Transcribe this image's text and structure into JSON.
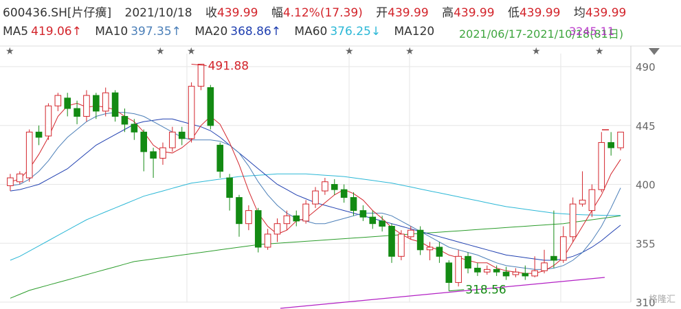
{
  "header": {
    "symbol": "600436.SH[片仔癀]",
    "date": "2021/10/18",
    "close_label": "收",
    "close": "439.99",
    "change_label": "幅",
    "change": "4.12%(17.39)",
    "open_label": "开",
    "open": "439.99",
    "high_label": "高",
    "high": "439.99",
    "low_label": "低",
    "low": "439.99",
    "avg_label": "均",
    "avg": "439.99"
  },
  "ma_row": {
    "ma5": "MA5",
    "ma5_val": "419.06↑",
    "ma10": "MA10",
    "ma10_val": "397.35↑",
    "ma20": "MA20",
    "ma20_val": "368.86↑",
    "ma60": "MA60",
    "ma60_val": "376.25↓",
    "ma120": "MA120",
    "ma120_val": "",
    "ma250_val": "3245.11",
    "overlay_text": "2021/06/17-2021/10/18(81日)"
  },
  "watermark": "格隆汇",
  "colors": {
    "up": "#d3242b",
    "down": "#138a13",
    "grid": "#e5e5e5"
  },
  "chart_data": {
    "type": "candlestick",
    "ylim": [
      310,
      500
    ],
    "yticks": [
      490,
      445,
      400,
      355,
      310
    ],
    "annotations": [
      {
        "text": "491.88",
        "x_index": 19,
        "y": 491.88
      },
      {
        "text": "318.56",
        "x_index": 46,
        "y": 318.56
      }
    ],
    "candles": [
      [
        399,
        405,
        395,
        408
      ],
      [
        402,
        408,
        400,
        410
      ],
      [
        405,
        440,
        402,
        442
      ],
      [
        440,
        436,
        430,
        445
      ],
      [
        437,
        460,
        434,
        462
      ],
      [
        460,
        468,
        456,
        470
      ],
      [
        466,
        458,
        452,
        470
      ],
      [
        458,
        452,
        446,
        464
      ],
      [
        452,
        468,
        448,
        472
      ],
      [
        468,
        456,
        450,
        470
      ],
      [
        456,
        470,
        452,
        474
      ],
      [
        470,
        452,
        448,
        472
      ],
      [
        452,
        446,
        440,
        458
      ],
      [
        446,
        440,
        434,
        450
      ],
      [
        440,
        425,
        410,
        442
      ],
      [
        425,
        420,
        405,
        428
      ],
      [
        420,
        428,
        415,
        432
      ],
      [
        428,
        440,
        425,
        444
      ],
      [
        440,
        435,
        430,
        444
      ],
      [
        435,
        475,
        432,
        478
      ],
      [
        475,
        491.88,
        472,
        491.88
      ],
      [
        474,
        445,
        442,
        476
      ],
      [
        430,
        410,
        405,
        432
      ],
      [
        405,
        390,
        380,
        408
      ],
      [
        390,
        370,
        360,
        392
      ],
      [
        370,
        380,
        365,
        384
      ],
      [
        380,
        352,
        348,
        382
      ],
      [
        352,
        362,
        350,
        366
      ],
      [
        362,
        370,
        356,
        374
      ],
      [
        370,
        376,
        365,
        380
      ],
      [
        376,
        372,
        368,
        380
      ],
      [
        372,
        385,
        370,
        388
      ],
      [
        385,
        395,
        382,
        398
      ],
      [
        395,
        402,
        392,
        405
      ],
      [
        400,
        396,
        392,
        404
      ],
      [
        396,
        390,
        386,
        400
      ],
      [
        390,
        380,
        376,
        394
      ],
      [
        380,
        375,
        372,
        384
      ],
      [
        375,
        370,
        366,
        380
      ],
      [
        372,
        368,
        364,
        376
      ],
      [
        368,
        345,
        340,
        370
      ],
      [
        345,
        362,
        342,
        365
      ],
      [
        360,
        365,
        358,
        368
      ],
      [
        365,
        350,
        346,
        368
      ],
      [
        350,
        352,
        342,
        356
      ],
      [
        352,
        345,
        340,
        356
      ],
      [
        340,
        325,
        318.56,
        342
      ],
      [
        325,
        345,
        322,
        350
      ],
      [
        345,
        336,
        332,
        348
      ],
      [
        336,
        333,
        330,
        340
      ],
      [
        333,
        335,
        331,
        338
      ],
      [
        335,
        333,
        330,
        338
      ],
      [
        333,
        330,
        327,
        337
      ],
      [
        331,
        333,
        329,
        336
      ],
      [
        332,
        330,
        327,
        338
      ],
      [
        330,
        334,
        329,
        345
      ],
      [
        334,
        340,
        332,
        350
      ],
      [
        345,
        342,
        336,
        380
      ],
      [
        342,
        360,
        340,
        368
      ],
      [
        360,
        385,
        356,
        390
      ],
      [
        385,
        388,
        383,
        410
      ],
      [
        380,
        396,
        375,
        400
      ],
      [
        396,
        432,
        394,
        440
      ],
      [
        432,
        428,
        422,
        440
      ],
      [
        428,
        439.99,
        426,
        439.99
      ]
    ],
    "ma5": [
      402,
      404,
      412,
      423,
      436,
      452,
      460,
      462,
      459,
      460,
      459,
      457,
      452,
      448,
      440,
      430,
      425,
      424,
      428,
      434,
      445,
      452,
      446,
      432,
      415,
      395,
      378,
      368,
      362,
      365,
      372,
      374,
      380,
      386,
      392,
      396,
      393,
      388,
      380,
      374,
      367,
      362,
      358,
      356,
      352,
      350,
      346,
      344,
      342,
      340,
      340,
      336,
      334,
      333,
      332,
      332,
      334,
      338,
      344,
      356,
      368,
      380,
      392,
      408,
      419.06
    ],
    "ma10": [
      399,
      400,
      404,
      410,
      418,
      428,
      436,
      442,
      448,
      452,
      454,
      455,
      455,
      454,
      452,
      448,
      444,
      440,
      436,
      434,
      434,
      434,
      433,
      430,
      424,
      414,
      402,
      392,
      384,
      378,
      374,
      372,
      370,
      370,
      372,
      374,
      376,
      378,
      378,
      378,
      376,
      372,
      368,
      364,
      360,
      356,
      352,
      350,
      348,
      346,
      343,
      340,
      338,
      337,
      336,
      335,
      335,
      336,
      338,
      342,
      348,
      357,
      368,
      382,
      397.35
    ],
    "ma20": [
      395,
      396,
      398,
      400,
      404,
      408,
      412,
      418,
      424,
      430,
      434,
      438,
      442,
      446,
      448,
      449,
      450,
      450,
      448,
      446,
      444,
      441,
      436,
      430,
      424,
      418,
      412,
      406,
      400,
      396,
      392,
      389,
      386,
      384,
      382,
      380,
      378,
      376,
      374,
      372,
      370,
      368,
      366,
      364,
      362,
      360,
      358,
      356,
      354,
      352,
      350,
      348,
      346,
      345,
      344,
      343,
      342,
      342,
      343,
      345,
      348,
      352,
      357,
      363,
      368.86
    ],
    "ma60": [
      342,
      345,
      349,
      353,
      357,
      361,
      365,
      369,
      373,
      376,
      379,
      382,
      385,
      388,
      391,
      393,
      395,
      397,
      399,
      401,
      402,
      403,
      404,
      405,
      406,
      406.5,
      407,
      407.5,
      408,
      408,
      408,
      408,
      407.5,
      407,
      406.5,
      406,
      405,
      404,
      403,
      402,
      401,
      399.5,
      398,
      396.5,
      395,
      393.5,
      392,
      390.5,
      389,
      387.5,
      386,
      384.5,
      383,
      382,
      381,
      380,
      379,
      378,
      377.5,
      377,
      376.8,
      376.6,
      376.4,
      376.3,
      376.25
    ],
    "ma120": [
      313,
      316,
      319,
      321,
      323,
      325,
      327,
      329,
      331,
      333,
      335,
      337,
      339,
      341,
      342,
      343,
      344,
      345,
      346,
      347,
      348,
      349,
      350,
      351,
      352,
      353,
      354,
      354.5,
      355,
      355.5,
      356,
      356.5,
      357,
      357.5,
      358,
      358.5,
      359,
      359.5,
      360,
      360.5,
      361,
      361.5,
      362,
      362.5,
      363,
      363.5,
      364,
      364.5,
      365,
      365.5,
      366,
      366.5,
      367,
      367.5,
      368,
      368.5,
      369,
      369.5,
      370,
      371,
      372,
      373,
      374,
      375,
      376
    ],
    "ma250": [
      null,
      null,
      null,
      null,
      null,
      null,
      null,
      null,
      null,
      null,
      null,
      null,
      null,
      null,
      null,
      null,
      null,
      null,
      null,
      null,
      null,
      null,
      null,
      null,
      null,
      null,
      null,
      null,
      null,
      null,
      null,
      null,
      null,
      null,
      null,
      null,
      null,
      null,
      null,
      null,
      null,
      null,
      null,
      null,
      null,
      null,
      null,
      null,
      null,
      null,
      null,
      null,
      null,
      null,
      null,
      null,
      null,
      null,
      null,
      null,
      null,
      null,
      null,
      null,
      null
    ]
  }
}
